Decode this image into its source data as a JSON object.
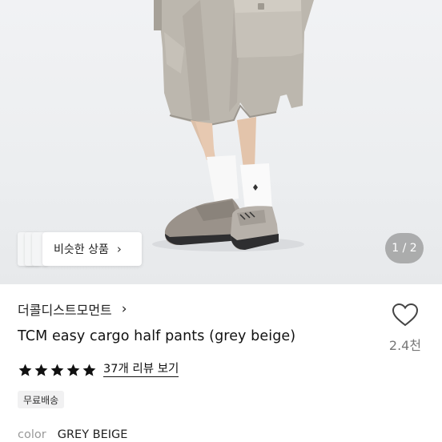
{
  "gallery": {
    "similar_button_label": "비슷한 상품",
    "pager": "1 / 2"
  },
  "product": {
    "brand": "더콜디스트모먼트",
    "title": "TCM easy cargo half pants (grey beige)",
    "like_count": "2.4천",
    "rating_stars": 5,
    "review_link": "37개 리뷰 보기",
    "tag": "무료배송",
    "option": {
      "label": "color",
      "value": "GREY BEIGE"
    }
  },
  "colors": {
    "star": "#111111",
    "pager_bg": "#8a8a8a",
    "pants": "#b9b4ab",
    "muted_text": "#999999"
  },
  "icons": {
    "chevron": "chevron-right-icon",
    "like": "heart-outline-icon",
    "star": "star-filled-icon"
  }
}
